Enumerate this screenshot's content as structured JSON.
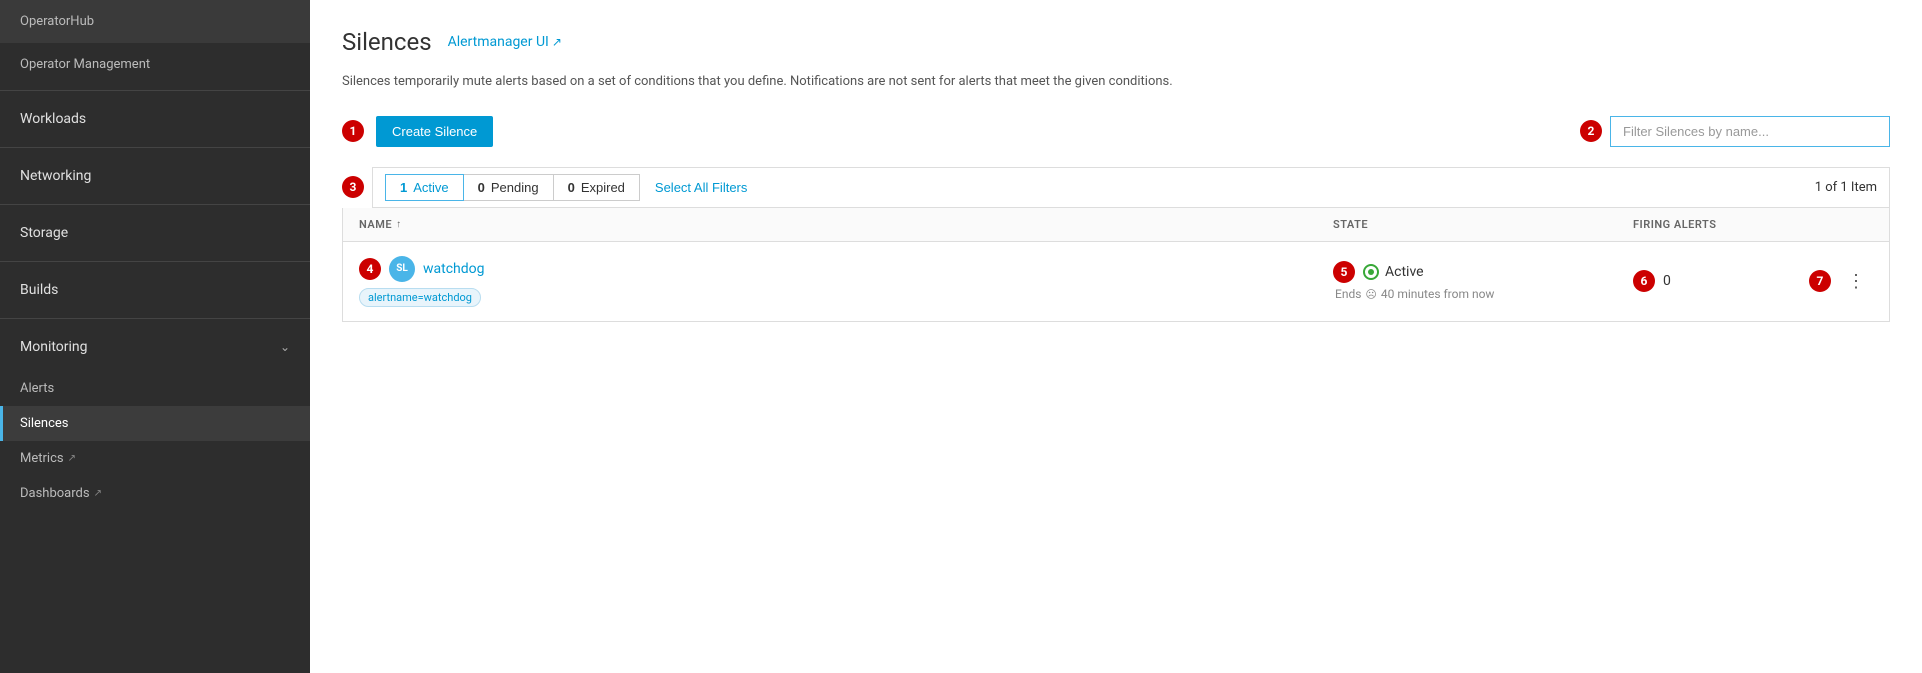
{
  "sidebar": {
    "top_items": [
      {
        "label": "OperatorHub"
      },
      {
        "label": "Operator Management"
      }
    ],
    "sections": [
      {
        "label": "Workloads",
        "expandable": false
      },
      {
        "label": "Networking",
        "expandable": false
      },
      {
        "label": "Storage",
        "expandable": false
      },
      {
        "label": "Builds",
        "expandable": false
      },
      {
        "label": "Monitoring",
        "expandable": true,
        "expanded": true,
        "subsections": [
          {
            "label": "Alerts",
            "active": false,
            "external": false
          },
          {
            "label": "Silences",
            "active": true,
            "external": false
          },
          {
            "label": "Metrics",
            "active": false,
            "external": true
          },
          {
            "label": "Dashboards",
            "active": false,
            "external": true
          }
        ]
      }
    ]
  },
  "page": {
    "title": "Silences",
    "alertmanager_link_label": "Alertmanager UI",
    "description": "Silences temporarily mute alerts based on a set of conditions that you define. Notifications are not sent for alerts that meet the given conditions.",
    "create_button_label": "Create Silence",
    "filter_placeholder": "Filter Silences by name..."
  },
  "filter_tabs": {
    "active": {
      "label": "Active",
      "count": "1",
      "selected": true
    },
    "pending": {
      "label": "Pending",
      "count": "0",
      "selected": false
    },
    "expired": {
      "label": "Expired",
      "count": "0",
      "selected": false
    },
    "select_all_label": "Select All Filters"
  },
  "table": {
    "item_count": "1 of 1 Item",
    "columns": {
      "name": "NAME",
      "state": "STATE",
      "firing_alerts": "FIRING ALERTS"
    },
    "rows": [
      {
        "avatar": "SL",
        "name": "watchdog",
        "tag": "alertname=watchdog",
        "state": "Active",
        "ends_label": "Ends",
        "ends_time": "40 minutes from now",
        "firing_alerts": "0"
      }
    ]
  },
  "badges": {
    "step1": "1",
    "step2": "2",
    "step3": "3",
    "step4": "4",
    "step5": "5",
    "step6": "6",
    "step7": "7"
  }
}
